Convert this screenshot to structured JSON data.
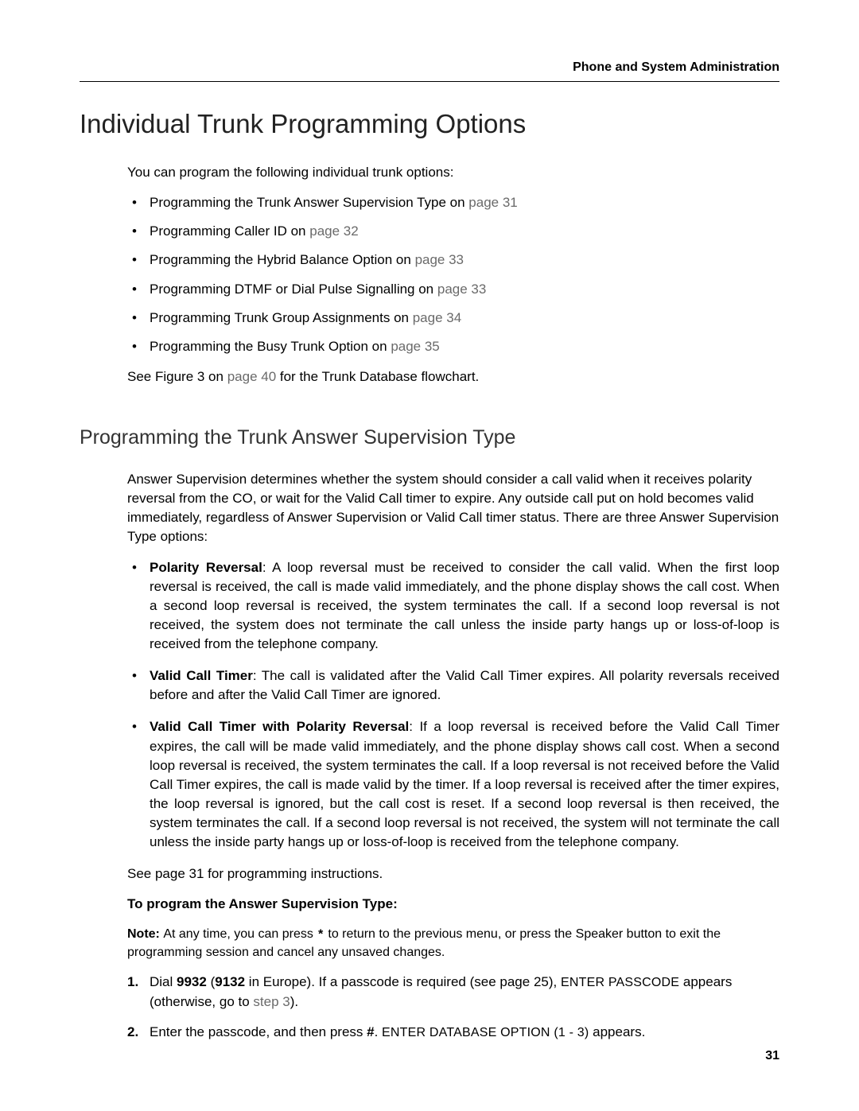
{
  "header": {
    "title": "Phone and System Administration"
  },
  "pageNumber": "31",
  "section": {
    "title": "Individual Trunk Programming Options",
    "intro": "You can program the following individual trunk options:",
    "links": [
      {
        "text": "Programming the Trunk Answer Supervision Type on ",
        "ref": "page 31"
      },
      {
        "text": "Programming Caller ID on ",
        "ref": "page 32"
      },
      {
        "text": "Programming the Hybrid Balance Option on ",
        "ref": "page 33"
      },
      {
        "text": "Programming DTMF or Dial Pulse Signalling on ",
        "ref": "page 33"
      },
      {
        "text": "Programming Trunk Group Assignments on ",
        "ref": "page 34"
      },
      {
        "text": "Programming the Busy Trunk Option on ",
        "ref": "page 35"
      }
    ],
    "seeFigure": {
      "before": "See Figure 3 on ",
      "ref": "page 40",
      "after": " for the Trunk Database flowchart."
    }
  },
  "subsection": {
    "title": "Programming the Trunk Answer Supervision Type",
    "intro": "Answer Supervision determines whether the system should consider a call valid when it receives polarity reversal from the CO, or wait for the Valid Call timer to expire. Any outside call put on hold becomes valid immediately, regardless of Answer Supervision or Valid Call timer status. There are three Answer Supervision Type options:",
    "options": [
      {
        "name": "Polarity Reversal",
        "desc": ": A loop reversal must be received to consider the call valid. When the first loop reversal is received, the call is made valid immediately, and the phone display shows the call cost. When a second loop reversal is received, the system terminates the call. If a second loop reversal is not received, the system does not terminate the call unless the inside party hangs up or loss-of-loop is received from the telephone company."
      },
      {
        "name": "Valid Call Timer",
        "desc": ": The call is validated after the Valid Call Timer expires. All polarity reversals received before and after the Valid Call Timer are ignored."
      },
      {
        "name": "Valid Call Timer with Polarity Reversal",
        "desc": ": If a loop reversal is received before the Valid Call Timer expires, the call will be made valid immediately, and the phone display shows call cost. When a second loop reversal is received, the system terminates the call. If a loop reversal is not received before the Valid Call Timer expires, the call is made valid by the timer. If a loop reversal is received after the timer expires, the loop reversal is ignored, but the call cost is reset. If a second loop reversal is then received, the system terminates the call. If a second loop reversal is not received, the system will not terminate the call unless the inside party hangs up or loss-of-loop is received from the telephone company."
      }
    ],
    "seeInstr": "See page 31 for programming instructions.",
    "instrHead": "To program the Answer Supervision Type:",
    "note": {
      "label": "Note: ",
      "before": "At any time, you can press ",
      "star": "*",
      "after": " to return to the previous menu, or press the Speaker button to exit the programming session and cancel any unsaved changes."
    },
    "steps": [
      {
        "p1": "Dial ",
        "b1": "9932",
        "p2": " (",
        "b2": "9132",
        "p3": " in Europe). If a passcode is required (see page 25), ",
        "code": "ENTER PASSCODE",
        "p4": " appears (otherwise, go to ",
        "ref": "step 3",
        "p5": ")."
      },
      {
        "p1": "Enter the passcode, and then press ",
        "b1": "#",
        "p2": ". ",
        "code": "ENTER DATABASE OPTION (1 - 3)",
        "p3": " appears."
      }
    ]
  }
}
